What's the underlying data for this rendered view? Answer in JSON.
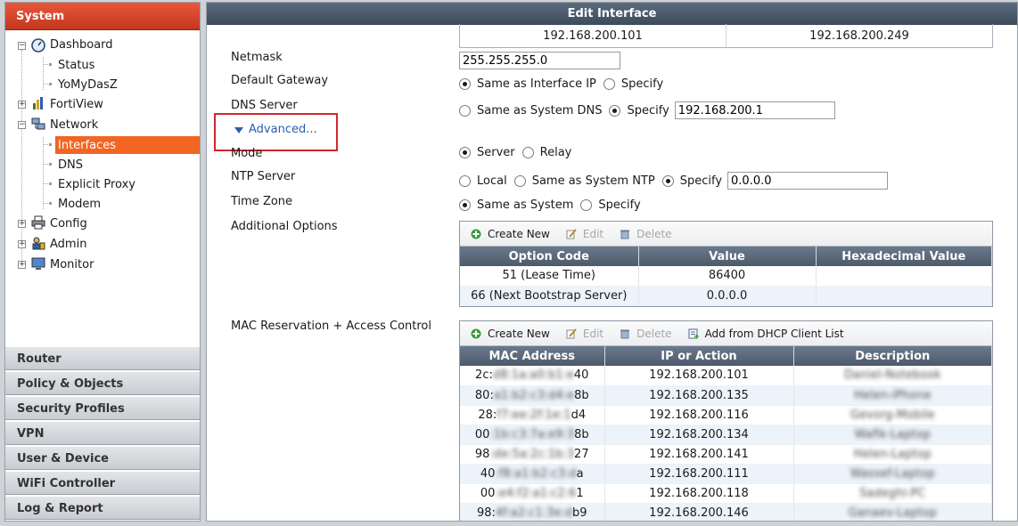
{
  "sidebar": {
    "header": "System",
    "tree": {
      "dashboard": "Dashboard",
      "status": "Status",
      "yomydasz": "YoMyDasZ",
      "fortiview": "FortiView",
      "network": "Network",
      "interfaces": "Interfaces",
      "dns": "DNS",
      "explicit_proxy": "Explicit Proxy",
      "modem": "Modem",
      "config": "Config",
      "admin": "Admin",
      "monitor": "Monitor"
    },
    "sections": [
      "Router",
      "Policy & Objects",
      "Security Profiles",
      "VPN",
      "User & Device",
      "WiFi Controller",
      "Log & Report"
    ]
  },
  "main": {
    "title": "Edit Interface",
    "ip_range": {
      "start": "192.168.200.101",
      "end": "192.168.200.249"
    },
    "labels": {
      "netmask": "Netmask",
      "gateway": "Default Gateway",
      "dns": "DNS Server",
      "advanced": "Advanced...",
      "mode": "Mode",
      "ntp": "NTP Server",
      "timezone": "Time Zone",
      "additional": "Additional Options",
      "mac": "MAC Reservation + Access Control"
    },
    "netmask_value": "255.255.255.0",
    "gateway_opts": {
      "a": "Same as Interface IP",
      "b": "Specify"
    },
    "dns_opts": {
      "a": "Same as System DNS",
      "b": "Specify",
      "value": "192.168.200.1"
    },
    "mode_opts": {
      "a": "Server",
      "b": "Relay"
    },
    "ntp_opts": {
      "a": "Local",
      "b": "Same as System NTP",
      "c": "Specify",
      "value": "0.0.0.0"
    },
    "tz_opts": {
      "a": "Same as System",
      "b": "Specify"
    }
  },
  "options_grid": {
    "toolbar": {
      "create": "Create New",
      "edit": "Edit",
      "delete": "Delete"
    },
    "columns": [
      "Option Code",
      "Value",
      "Hexadecimal Value"
    ],
    "rows": [
      [
        "51 (Lease Time)",
        "86400",
        ""
      ],
      [
        "66 (Next Bootstrap Server)",
        "0.0.0.0",
        ""
      ]
    ]
  },
  "mac_grid": {
    "toolbar": {
      "create": "Create New",
      "edit": "Edit",
      "delete": "Delete",
      "add": "Add from DHCP Client List"
    },
    "columns": [
      "MAC Address",
      "IP or Action",
      "Description"
    ],
    "rows": [
      {
        "mac_pre": "2c:",
        "mac_hidden": "d8:1a:a0:b1:e",
        "mac_post": "40",
        "ip": "192.168.200.101",
        "desc": "Daniel-Notebook"
      },
      {
        "mac_pre": "80:",
        "mac_hidden": "a1:b2:c3:d4:e",
        "mac_post": "8b",
        "ip": "192.168.200.135",
        "desc": "Helen-iPhone"
      },
      {
        "mac_pre": "28:",
        "mac_hidden": "f7:ee:2f:1e:1",
        "mac_post": "d4",
        "ip": "192.168.200.116",
        "desc": "Gevorg-Mobile"
      },
      {
        "mac_pre": "00",
        "mac_hidden": ":1b:c3:7a:e9:3",
        "mac_post": "8b",
        "ip": "192.168.200.134",
        "desc": "Wafik-Laptop"
      },
      {
        "mac_pre": "98",
        "mac_hidden": ":de:5a:2c:1b:3",
        "mac_post": "27",
        "ip": "192.168.200.141",
        "desc": "Helen-Laptop"
      },
      {
        "mac_pre": "40",
        "mac_hidden": ":f8:a1:b2:c3:d",
        "mac_post": "a",
        "ip": "192.168.200.111",
        "desc": "Wassef-Laptop"
      },
      {
        "mac_pre": "00",
        "mac_hidden": ":e4:f2:a1:c2:6",
        "mac_post": "1",
        "ip": "192.168.200.118",
        "desc": "Sadeghi-PC"
      },
      {
        "mac_pre": "98:",
        "mac_hidden": "4f:a2:c1:3e:d",
        "mac_post": "b9",
        "ip": "192.168.200.146",
        "desc": "Ganaev-Laptop"
      }
    ]
  }
}
